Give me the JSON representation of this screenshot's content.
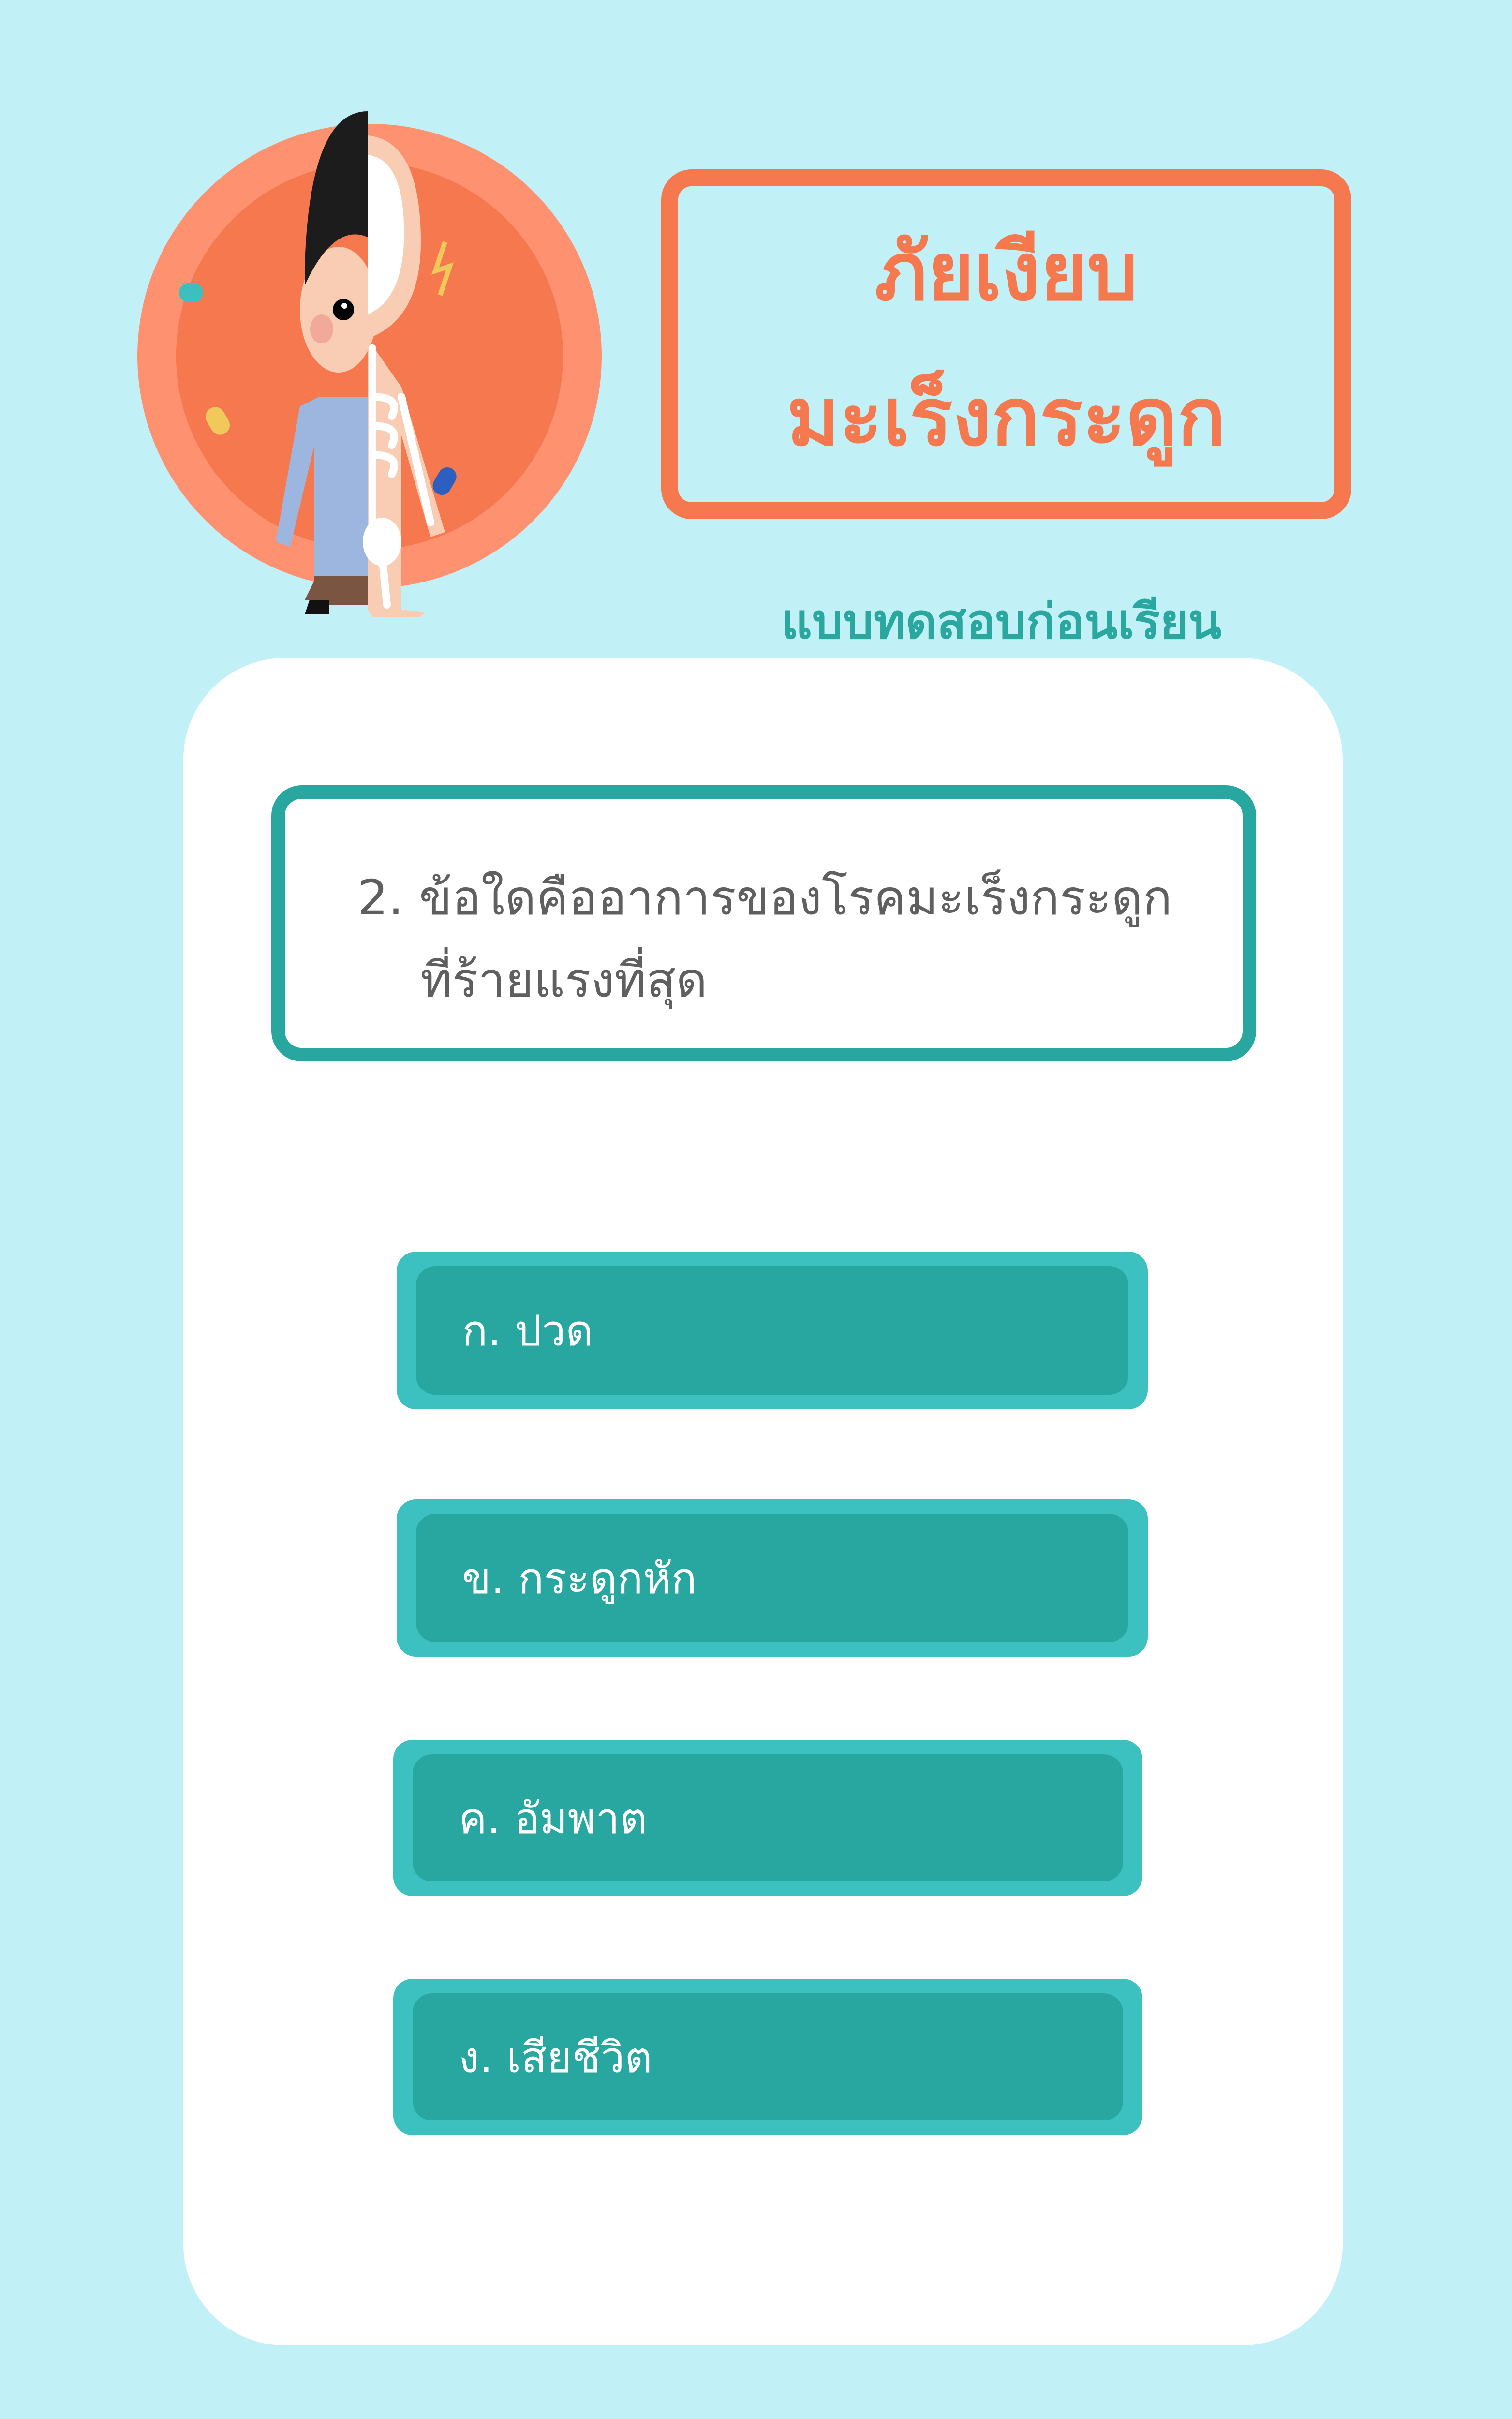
{
  "header": {
    "title_line1": "ภัยเงียบ",
    "title_line2": "มะเร็งกระดูก",
    "subtitle": "แบบทดสอบก่อนเรียน"
  },
  "question": {
    "number": "2.",
    "line1": "ข้อใดคืออาการของโรคมะเร็งกระดูก",
    "line2": "ที่ร้ายแรงที่สุด"
  },
  "options": [
    {
      "label": "ก. ปวด"
    },
    {
      "label": "ข. กระดูกหัก"
    },
    {
      "label": "ค. อัมพาต"
    },
    {
      "label": "ง. เสียชีวิต"
    }
  ],
  "colors": {
    "background": "#c2f0f7",
    "accent_orange": "#f5784f",
    "teal": "#28a7a0",
    "teal_light": "#3dc0c0"
  }
}
